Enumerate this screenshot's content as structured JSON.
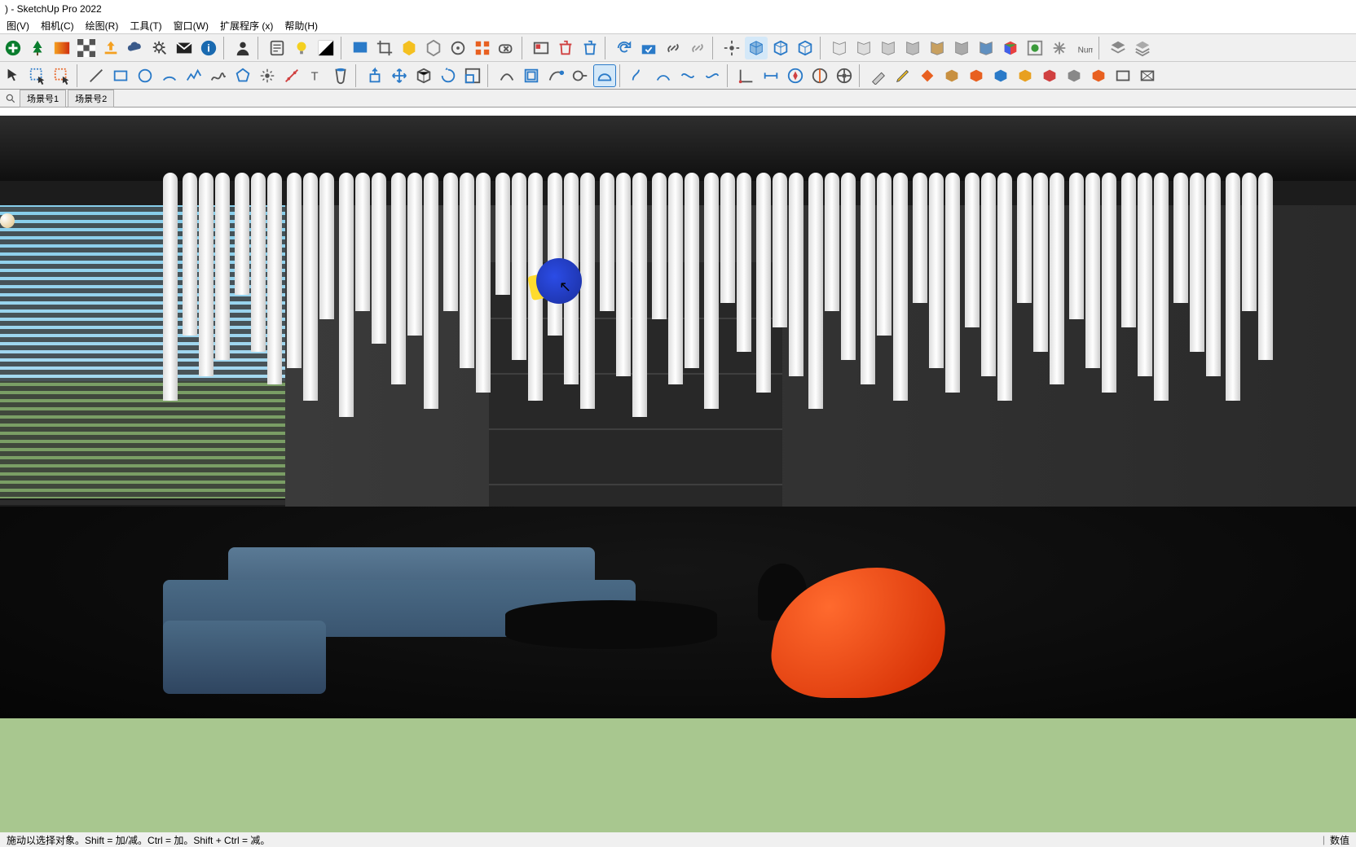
{
  "title": ")  - SketchUp Pro 2022",
  "menu": {
    "view": "图(V)",
    "camera": "相机(C)",
    "draw": "绘图(R)",
    "tools": "工具(T)",
    "window": "窗口(W)",
    "extensions": "扩展程序 (x)",
    "help": "帮助(H)"
  },
  "scenes": {
    "scene1": "场景号1",
    "scene2": "场景号2"
  },
  "status": {
    "hint": "施动以选择对象。Shift = 加/减。Ctrl = 加。Shift + Ctrl = 减。",
    "value_label": "数值"
  },
  "icons": {
    "add": "add-icon",
    "tree": "tree-icon",
    "gradient": "gradient-icon",
    "checker": "checker-icon",
    "upload": "upload-icon",
    "cloud": "cloud-icon",
    "gear": "gear-icon",
    "mail": "mail-icon",
    "info": "info-icon",
    "person": "person-icon",
    "note": "note-icon",
    "bulb": "bulb-icon",
    "contrast": "contrast-icon",
    "paint": "paint-icon",
    "crop": "crop-icon",
    "hex-y": "hex-yellow-icon",
    "hex-g": "hex-gray-icon",
    "target": "target-icon",
    "grid": "grid-icon",
    "erase": "erase-icon",
    "card": "card-icon",
    "trash": "trash-icon",
    "trash2": "trash2-icon",
    "refresh": "refresh-icon",
    "box-check": "box-check-icon",
    "link": "link-icon",
    "link2": "link2-icon",
    "center": "center-icon",
    "cube1": "cube1-icon",
    "cube2": "cube2-icon",
    "cube3": "cube3-icon",
    "book1": "book1-icon",
    "book2": "book2-icon",
    "book3": "book3-icon",
    "book4": "book4-icon",
    "book5": "book5-icon",
    "book6": "book6-icon",
    "book7": "book7-icon",
    "cubec": "cubec-icon",
    "style": "style-icon",
    "asterisk": "asterisk-icon",
    "num": "num-icon",
    "layers": "layers-icon",
    "layers2": "layers2-icon"
  }
}
